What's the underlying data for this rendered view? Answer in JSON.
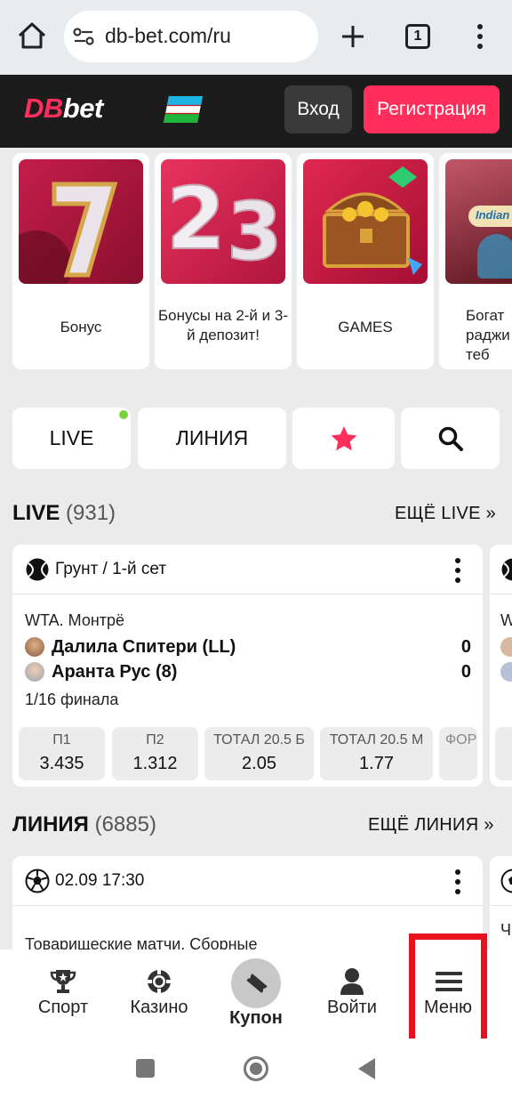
{
  "browser": {
    "url": "db-bet.com/ru",
    "tab_count": "1"
  },
  "header": {
    "logo": "DBbet",
    "login_label": "Вход",
    "register_label": "Регистрация"
  },
  "promos": [
    {
      "caption": "Бонус"
    },
    {
      "caption": "Бонусы на 2-й и 3-й депозит!"
    },
    {
      "caption": "GAMES"
    },
    {
      "caption": "Богат раджи теб",
      "image_text": "Indian"
    }
  ],
  "tabs": {
    "live": "LIVE",
    "line": "ЛИНИЯ"
  },
  "live_section": {
    "title": "LIVE",
    "count": "(931)",
    "more": "ЕЩЁ LIVE »"
  },
  "live_card": {
    "sport_label": "Грунт / 1-й сет",
    "league": "WTA. Монтрё",
    "players": [
      {
        "name": "Далила Спитери (LL)",
        "score": "0"
      },
      {
        "name": "Аранта Рус (8)",
        "score": "0"
      }
    ],
    "stage": "1/16 финала",
    "odds": [
      {
        "label": "П1",
        "value": "3.435"
      },
      {
        "label": "П2",
        "value": "1.312"
      },
      {
        "label": "ТОТАЛ 20.5 Б",
        "value": "2.05"
      },
      {
        "label": "ТОТАЛ 20.5 М",
        "value": "1.77"
      },
      {
        "label": "ФОР",
        "value": ""
      }
    ],
    "next_card_league": "W"
  },
  "line_section": {
    "title": "ЛИНИЯ",
    "count": "(6885)",
    "more": "ЕЩЁ ЛИНИЯ »"
  },
  "line_card": {
    "datetime": "02.09 17:30",
    "league": "Товарищеские матчи. Сборные",
    "next_card_league": "Ч"
  },
  "bottom_nav": [
    {
      "label": "Спорт",
      "icon": "trophy-icon"
    },
    {
      "label": "Казино",
      "icon": "casino-chip-icon"
    },
    {
      "label": "Купон",
      "icon": "ticket-icon"
    },
    {
      "label": "Войти",
      "icon": "user-icon"
    },
    {
      "label": "Меню",
      "icon": "hamburger-icon"
    }
  ],
  "colors": {
    "accent": "#ff2e5b",
    "header_bg": "#1c1c1c",
    "live_dot": "#7bd13b",
    "highlight_box": "#e8121e"
  }
}
